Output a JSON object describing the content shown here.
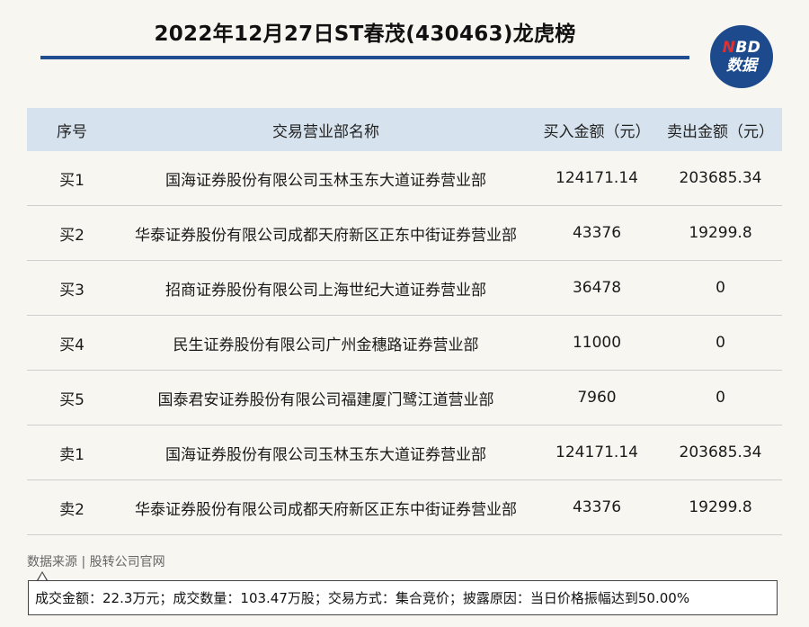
{
  "title": "2022年12月27日ST春茂(430463)龙虎榜",
  "logo": {
    "line1_n": "N",
    "line1_rest": "BD",
    "line2": "数据"
  },
  "table": {
    "headers": [
      "序号",
      "交易营业部名称",
      "买入金额（元）",
      "卖出金额（元）"
    ],
    "rows": [
      [
        "买1",
        "国海证券股份有限公司玉林玉东大道证券营业部",
        "124171.14",
        "203685.34"
      ],
      [
        "买2",
        "华泰证券股份有限公司成都天府新区正东中街证券营业部",
        "43376",
        "19299.8"
      ],
      [
        "买3",
        "招商证券股份有限公司上海世纪大道证券营业部",
        "36478",
        "0"
      ],
      [
        "买4",
        "民生证券股份有限公司广州金穗路证券营业部",
        "11000",
        "0"
      ],
      [
        "买5",
        "国泰君安证券股份有限公司福建厦门鹭江道营业部",
        "7960",
        "0"
      ],
      [
        "卖1",
        "国海证券股份有限公司玉林玉东大道证券营业部",
        "124171.14",
        "203685.34"
      ],
      [
        "卖2",
        "华泰证券股份有限公司成都天府新区正东中街证券营业部",
        "43376",
        "19299.8"
      ]
    ]
  },
  "source": "数据来源 | 股转公司官网",
  "note": "成交金额：22.3万元；成交数量：103.47万股；交易方式：集合竞价；披露原因：当日价格振幅达到50.00%",
  "colors": {
    "accent": "#1f4d8f",
    "header_bg": "#d6e3ee",
    "logo_bg": "#1c4a8c",
    "logo_n": "#e0302f"
  }
}
